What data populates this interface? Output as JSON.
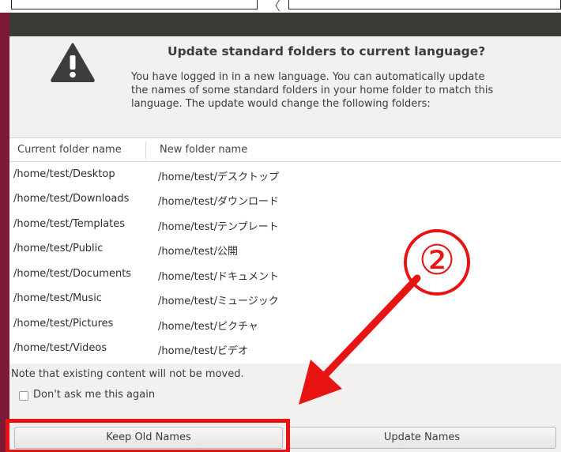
{
  "strip": {
    "separator_char": "〈"
  },
  "dialog": {
    "title": "Update standard folders to current language?",
    "description_lines": [
      "You have logged in in a new language. You can automatically update",
      "the names of some standard folders in your home folder to match this",
      "language. The update would change the following folders:"
    ]
  },
  "table": {
    "headers": [
      "Current folder name",
      "New folder name"
    ],
    "rows": [
      {
        "current": "/home/test/Desktop",
        "new": "/home/test/デスクトップ"
      },
      {
        "current": "/home/test/Downloads",
        "new": "/home/test/ダウンロード"
      },
      {
        "current": "/home/test/Templates",
        "new": "/home/test/テンプレート"
      },
      {
        "current": "/home/test/Public",
        "new": "/home/test/公開"
      },
      {
        "current": "/home/test/Documents",
        "new": "/home/test/ドキュメント"
      },
      {
        "current": "/home/test/Music",
        "new": "/home/test/ミュージック"
      },
      {
        "current": "/home/test/Pictures",
        "new": "/home/test/ピクチャ"
      },
      {
        "current": "/home/test/Videos",
        "new": "/home/test/ビデオ"
      }
    ]
  },
  "footer": {
    "note": "Note that existing content will not be moved.",
    "checkbox_label": "Don't ask me this again",
    "checkbox_checked": false
  },
  "buttons": {
    "keep_label": "Keep Old Names",
    "update_label": "Update Names"
  },
  "annotation": {
    "callout_number": "②",
    "color": "#e81414"
  },
  "colors": {
    "frame": "#7d1a36",
    "titlebar": "#3b3a36",
    "dialog_bg": "#f2f1f0"
  }
}
